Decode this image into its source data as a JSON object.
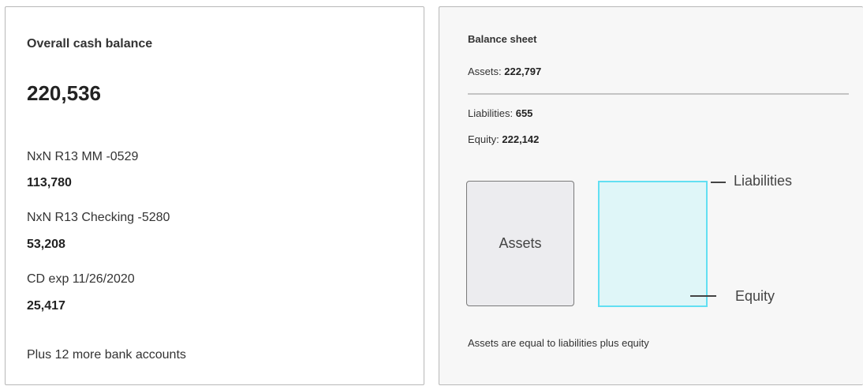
{
  "cash_card": {
    "title": "Overall cash balance",
    "total": "220,536",
    "accounts": [
      {
        "name": "NxN R13 MM -0529",
        "balance": "113,780"
      },
      {
        "name": "NxN R13 Checking -5280",
        "balance": "53,208"
      },
      {
        "name": "CD exp 11/26/2020",
        "balance": "25,417"
      }
    ],
    "more_link": "Plus 12 more bank accounts"
  },
  "balance_sheet": {
    "title": "Balance sheet",
    "assets_label": "Assets:",
    "assets_value": "222,797",
    "liabilities_label": "Liabilities:",
    "liabilities_value": "655",
    "equity_label": "Equity:",
    "equity_value": "222,142",
    "diagram": {
      "assets_box_label": "Assets",
      "liabilities_callout": "Liabilities",
      "equity_callout": "Equity",
      "colors": {
        "assets_fill": "#ececef",
        "assets_border": "#7a7a7a",
        "equity_fill": "#dff6f8",
        "equity_border": "#62dff2"
      }
    },
    "footnote": "Assets are equal to liabilities plus equity"
  }
}
